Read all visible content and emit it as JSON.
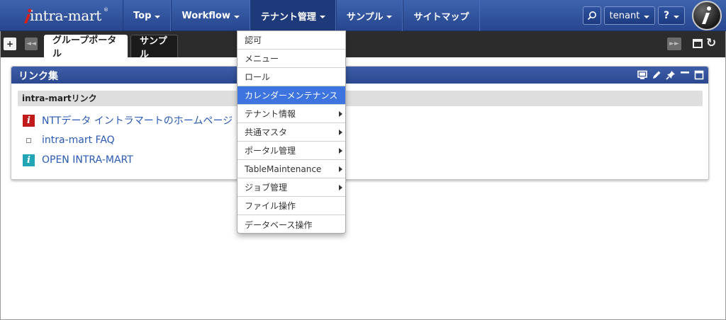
{
  "header": {
    "logo_text": "intra-mart",
    "logo_registered": "®",
    "nav": [
      {
        "label": "Top"
      },
      {
        "label": "Workflow"
      },
      {
        "label": "テナント管理"
      },
      {
        "label": "サンプル"
      },
      {
        "label": "サイトマップ"
      }
    ],
    "search_icon": "magnifier-icon",
    "user_label": "tenant",
    "help_label": "?"
  },
  "tabbar": {
    "add_label": "+",
    "prev_label": "◄◄",
    "next_label": "►►",
    "tabs": [
      {
        "label": "グループポータル",
        "active": true
      },
      {
        "label": "サンプル",
        "active": false
      }
    ]
  },
  "portlet": {
    "title": "リンク集",
    "section_label": "intra-martリンク",
    "links": [
      {
        "label": "NTTデータ イントラマートのホームページ",
        "icon": "intramart-red-icon"
      },
      {
        "label": "intra-mart FAQ",
        "icon": "blank-page-icon"
      },
      {
        "label": "OPEN INTRA-MART",
        "icon": "intramart-teal-icon"
      }
    ]
  },
  "dropdown": {
    "items": [
      {
        "label": "認可",
        "submenu": false
      },
      {
        "label": "メニュー",
        "submenu": false
      },
      {
        "label": "ロール",
        "submenu": false
      },
      {
        "label": "カレンダーメンテナンス",
        "submenu": false,
        "highlighted": true
      },
      {
        "label": "テナント情報",
        "submenu": true
      },
      {
        "label": "共通マスタ",
        "submenu": true
      },
      {
        "label": "ポータル管理",
        "submenu": true
      },
      {
        "label": "TableMaintenance",
        "submenu": true
      },
      {
        "label": "ジョブ管理",
        "submenu": true
      },
      {
        "label": "ファイル操作",
        "submenu": false
      },
      {
        "label": "データベース操作",
        "submenu": false
      }
    ]
  },
  "colors": {
    "header_blue": "#2f51a0",
    "portlet_header": "#3657a3",
    "menu_highlight": "#3d74df",
    "link_blue": "#2a5ab3",
    "tabbar_dark": "#2c2c2c"
  }
}
